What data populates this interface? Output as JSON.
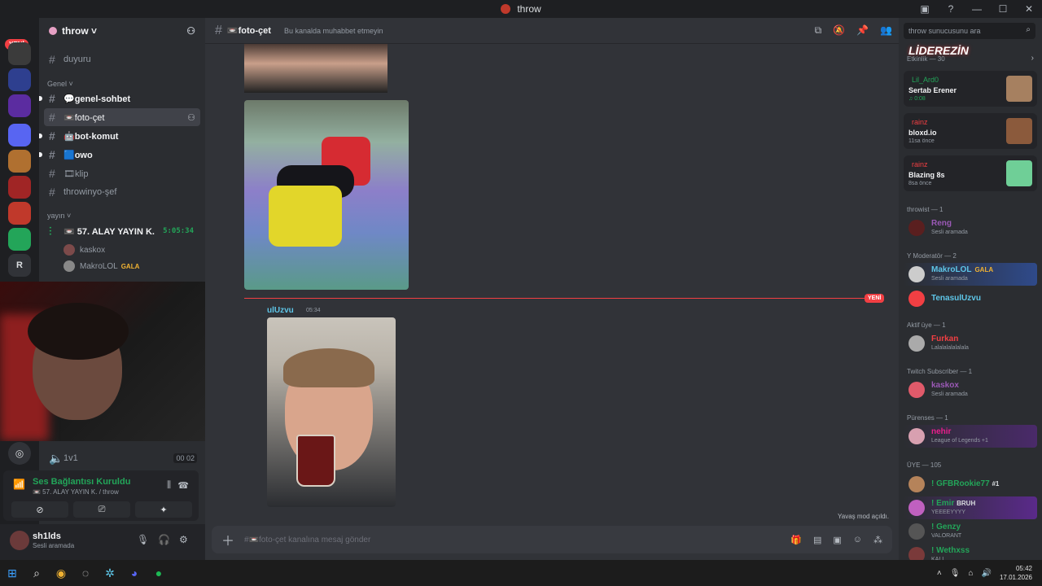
{
  "window": {
    "title": "throw"
  },
  "guilds": {
    "new_label": "YENİ",
    "badges": [
      "2",
      "1"
    ],
    "letter": "R"
  },
  "server": {
    "name": "throw ˅"
  },
  "channels": [
    {
      "name": "duyuru",
      "state": "muted"
    },
    {
      "name": "💬genel-sohbet",
      "state": "unread"
    },
    {
      "name": "📼foto-çet",
      "state": "active"
    },
    {
      "name": "🤖bot-komut",
      "state": "unread"
    },
    {
      "name": "🟦owo",
      "state": "unread"
    },
    {
      "name": "🎞klip",
      "state": "muted"
    },
    {
      "name": "throwinyo-şef",
      "state": "muted"
    }
  ],
  "categories": {
    "genel": "Genel ˅",
    "yayin": "yayın ˅"
  },
  "voice_channel": {
    "name": "📼 57. ALAY YAYIN K.",
    "timer": "5:05:34",
    "users": [
      {
        "name": "kaskox"
      },
      {
        "name": "MakroLOL",
        "badge": "GALA"
      }
    ]
  },
  "voice_channel2": {
    "name": "1v1",
    "count_a": "00",
    "count_b": "02"
  },
  "voice_status": {
    "title": "Ses Bağlantısı Kuruldu",
    "subtitle": "📼 57. ALAY YAYIN K. / throw"
  },
  "user": {
    "name": "sh1lds",
    "status": "Sesli aramada"
  },
  "channel_header": {
    "name": "📼foto-çet",
    "topic": "Bu kanalda muhabbet etmeyin"
  },
  "messages": {
    "new_label": "YENİ",
    "author": "ulUzvu",
    "time": "05:34"
  },
  "composer": {
    "placeholder": "#📼foto-çet kanalına mesaj gönder",
    "slow_mode": "Yavaş mod açıldı."
  },
  "members": {
    "search_placeholder": "throw sunucusunu ara",
    "brand": "LİDEREZİN",
    "activity_header": "Etkinlik — 30",
    "activities": [
      {
        "user": "Lil_Ard0",
        "title": "Sertab Erener",
        "sub": "♫ 0:08",
        "user_color": "#23a559"
      },
      {
        "user": "rainz",
        "title": "bloxd.io",
        "sub": "11sa önce",
        "user_color": "#f23f43"
      },
      {
        "user": "rainz",
        "title": "Blazing 8s",
        "sub": "8sa önce",
        "user_color": "#f23f43"
      }
    ],
    "groups": [
      {
        "label": "throwist — 1",
        "members": [
          {
            "name": "Reng",
            "status": "Sesli aramada",
            "color": "#9b59b6"
          }
        ]
      },
      {
        "label": "Y Moderatör — 2",
        "members": [
          {
            "name": "MakroLOL",
            "badge": "GALA",
            "status": "Sesli aramada",
            "color": "#5ec6e8"
          },
          {
            "name": "TenasulUzvu",
            "status": "",
            "color": "#5ec6e8"
          }
        ]
      },
      {
        "label": "Aktif üye — 1",
        "members": [
          {
            "name": "Furkan",
            "status": "Lalalalalalalala",
            "color": "#f23f43"
          }
        ]
      },
      {
        "label": "Twitch Subscriber — 1",
        "members": [
          {
            "name": "kaskox",
            "status": "Sesli aramada",
            "color": "#9b59b6"
          }
        ]
      },
      {
        "label": "Pürenses — 1",
        "members": [
          {
            "name": "nehir",
            "status": "League of Legends +1",
            "color": "#e91e8c"
          }
        ]
      },
      {
        "label": "ÜYE — 105",
        "members": [
          {
            "name": "! GFBRookie77",
            "badge": "#1",
            "status": "",
            "color": "#23a559"
          },
          {
            "name": "! Emir",
            "badge": "BRUH",
            "status": "YEEEEYYYY",
            "color": "#23a559"
          },
          {
            "name": "! Genzy",
            "status": "VALORANT",
            "color": "#23a559"
          },
          {
            "name": "! Wethxss",
            "status": "KALI",
            "color": "#23a559"
          }
        ]
      }
    ]
  },
  "taskbar": {
    "time": "05:42",
    "date": "17.01.2026"
  }
}
